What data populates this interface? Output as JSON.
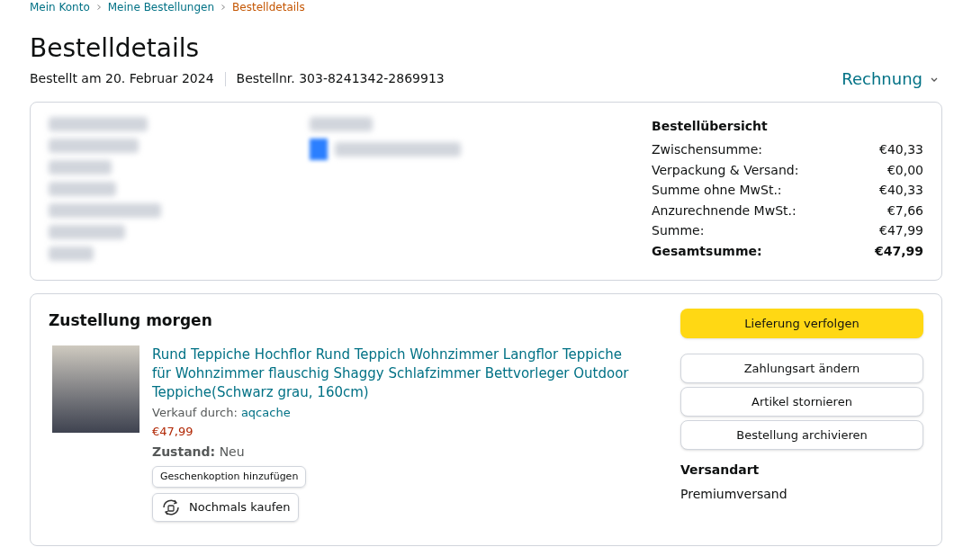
{
  "breadcrumb": [
    {
      "label": "Mein Konto",
      "current": false
    },
    {
      "label": "Meine Bestellungen",
      "current": false
    },
    {
      "label": "Bestelldetails",
      "current": true
    }
  ],
  "title": "Bestelldetails",
  "order_date": "Bestellt am 20. Februar 2024",
  "order_number": "Bestellnr. 303-8241342-2869913",
  "invoice_menu": "Rechnung",
  "summary": {
    "heading": "Bestellübersicht",
    "rows": [
      {
        "label": "Zwischensumme:",
        "value": "€40,33",
        "bold": false
      },
      {
        "label": "Verpackung & Versand:",
        "value": "€0,00",
        "bold": false
      },
      {
        "label": "Summe ohne MwSt.:",
        "value": "€40,33",
        "bold": false
      },
      {
        "label": "Anzurechnende MwSt.:",
        "value": "€7,66",
        "bold": false
      },
      {
        "label": "Summe:",
        "value": "€47,99",
        "bold": false
      },
      {
        "label": "Gesamtsumme:",
        "value": "€47,99",
        "bold": true
      }
    ]
  },
  "shipment": {
    "heading": "Zustellung morgen",
    "product": {
      "title": "Rund Teppiche Hochflor Rund Teppich Wohnzimmer Langflor Teppiche für Wohnzimmer flauschig Shaggy Schlafzimmer Bettvorleger Outdoor Teppiche(Schwarz grau, 160cm)",
      "seller_label": "Verkauf durch:",
      "seller": "aqcache",
      "price": "€47,99",
      "condition_label": "Zustand:",
      "condition": "Neu",
      "gift_button": "Geschenkoption hinzufügen",
      "rebuy_button": "Nochmals kaufen"
    },
    "actions": [
      {
        "label": "Lieferung verfolgen",
        "kind": "primary"
      },
      {
        "label": "Zahlungsart ändern",
        "kind": "secondary"
      },
      {
        "label": "Artikel stornieren",
        "kind": "secondary"
      },
      {
        "label": "Bestellung archivieren",
        "kind": "secondary"
      }
    ],
    "shipping_heading": "Versandart",
    "shipping_method": "Premiumversand"
  }
}
